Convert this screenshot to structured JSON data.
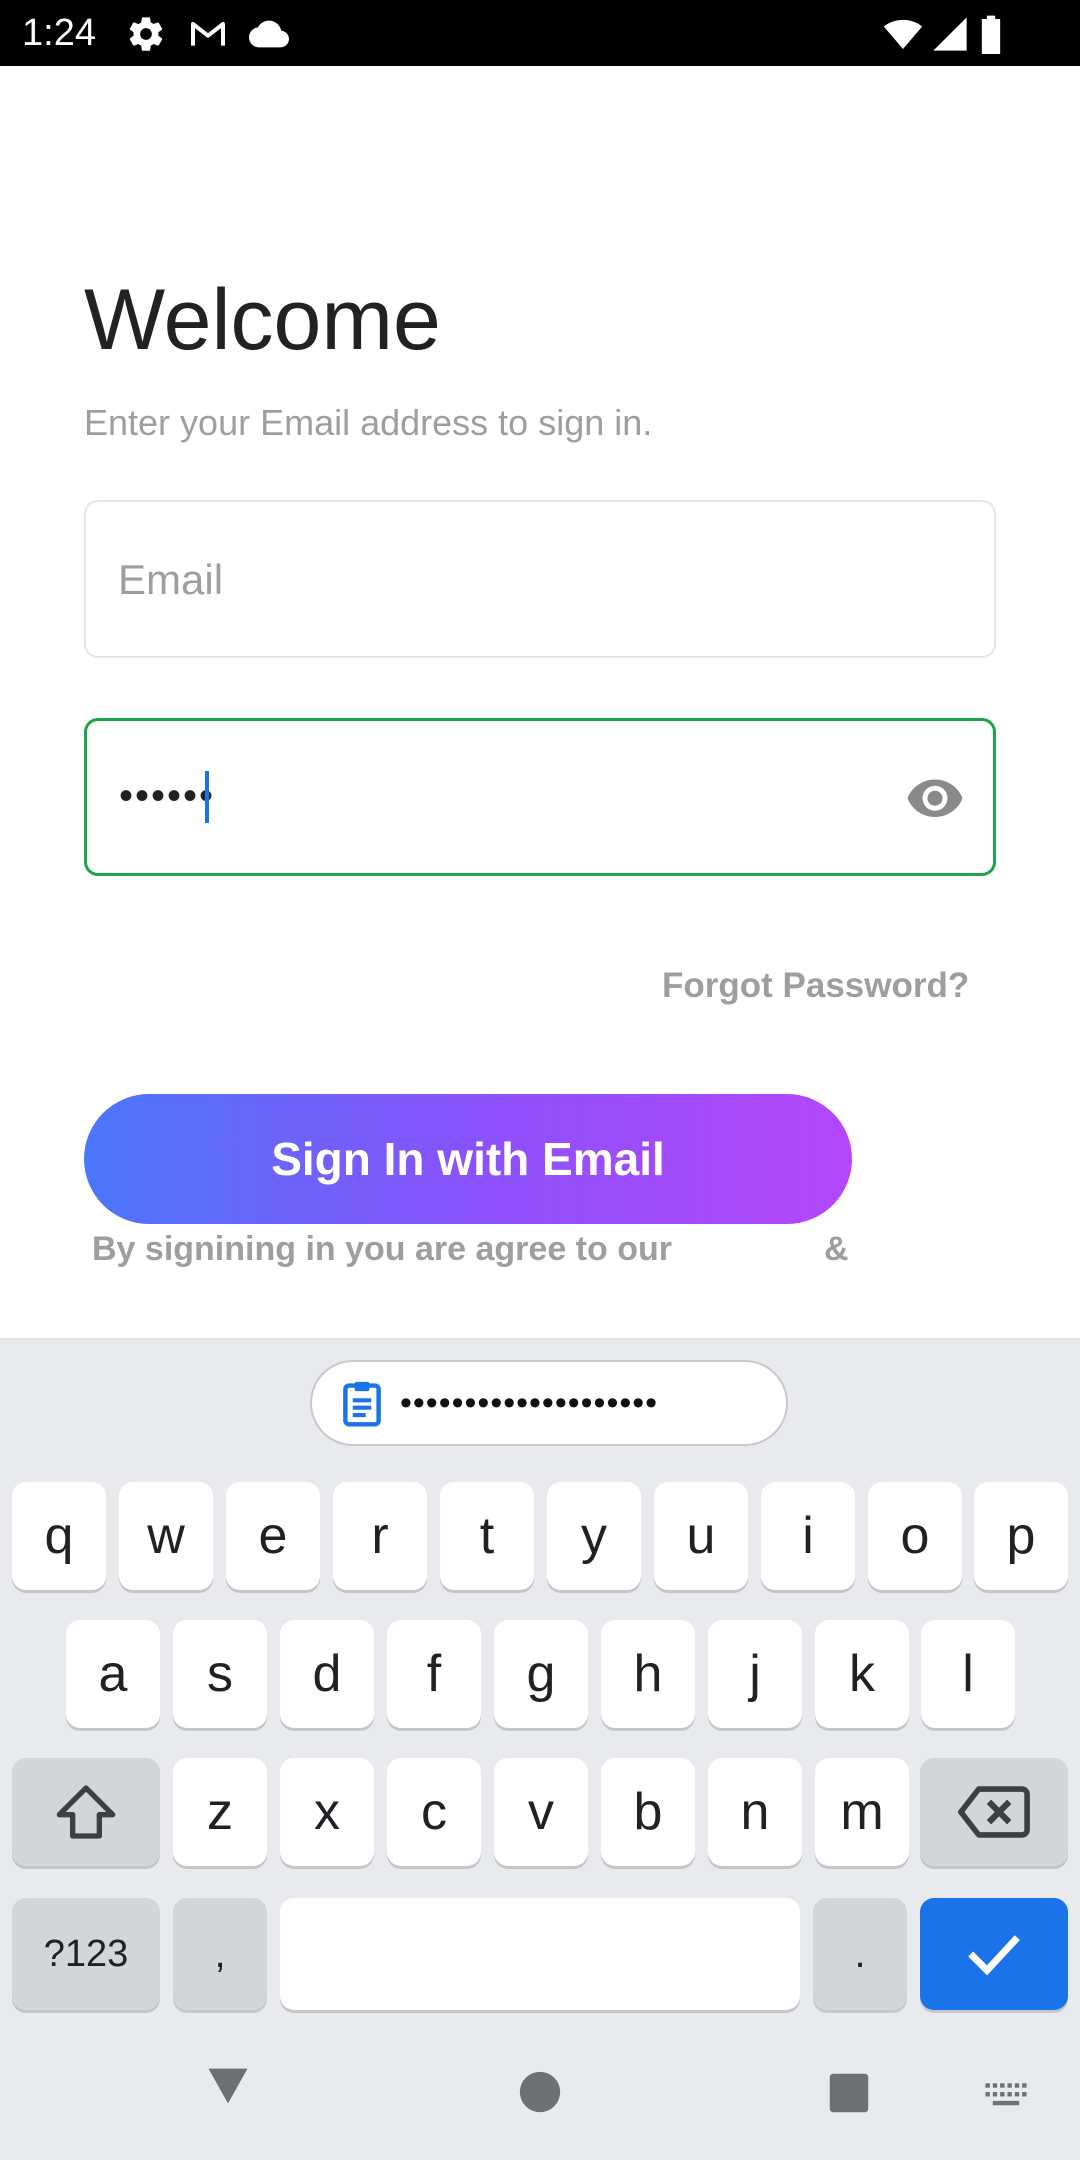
{
  "status_bar": {
    "time": "1:24",
    "left_icons": [
      "settings-icon",
      "gmail-icon",
      "cloud-icon"
    ],
    "right_icons": [
      "wifi-icon",
      "signal-icon",
      "battery-icon"
    ]
  },
  "login": {
    "title": "Welcome",
    "subtitle": "Enter your Email address to sign in.",
    "email_placeholder": "Email",
    "email_value": "",
    "password_value": "••••••",
    "password_toggle_icon": "eye-icon",
    "forgot_password": "Forgot Password?",
    "sign_in_button": "Sign In with Email",
    "agreement_text": "By signining in you are agree to our",
    "agreement_ampersand": "&",
    "focused_border_color": "#1ea54b",
    "button_gradient": [
      "#4a77fb",
      "#b546fb"
    ]
  },
  "keyboard": {
    "suggestion_icon": "clipboard-icon",
    "suggestion_text": "••••••••••••••••••••",
    "row1": [
      "q",
      "w",
      "e",
      "r",
      "t",
      "y",
      "u",
      "i",
      "o",
      "p"
    ],
    "row2": [
      "a",
      "s",
      "d",
      "f",
      "g",
      "h",
      "j",
      "k",
      "l"
    ],
    "row3": [
      "z",
      "x",
      "c",
      "v",
      "b",
      "n",
      "m"
    ],
    "symbols_key": "?123",
    "comma_key": ",",
    "period_key": ".",
    "shift_icon": "shift-icon",
    "backspace_icon": "backspace-icon",
    "enter_icon": "checkmark-icon",
    "accent_color": "#1a73e8"
  },
  "nav_bar": {
    "items": [
      "back-icon",
      "home-icon",
      "recents-icon",
      "keyboard-switch-icon"
    ]
  }
}
